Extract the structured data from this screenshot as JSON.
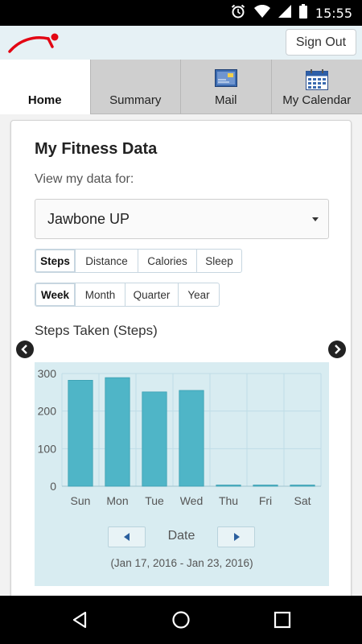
{
  "status_bar": {
    "time": "15:55",
    "icons": [
      "alarm-icon",
      "wifi-icon",
      "cell-signal-icon",
      "battery-icon"
    ]
  },
  "header": {
    "sign_out_label": "Sign Out",
    "logo": "brand-logo-swoosh"
  },
  "tabs": [
    {
      "label": "Home",
      "active": true
    },
    {
      "label": "Summary",
      "active": false
    },
    {
      "label": "Mail",
      "icon": "mail-icon",
      "active": false
    },
    {
      "label": "My Calendar",
      "icon": "calendar-icon",
      "active": false
    }
  ],
  "card": {
    "title": "My Fitness Data",
    "view_label": "View my data for:",
    "device_select": {
      "value": "Jawbone UP"
    },
    "metric_tabs": [
      {
        "label": "Steps",
        "active": true
      },
      {
        "label": "Distance",
        "active": false
      },
      {
        "label": "Calories",
        "active": false
      },
      {
        "label": "Sleep",
        "active": false
      }
    ],
    "period_tabs": [
      {
        "label": "Week",
        "active": true
      },
      {
        "label": "Month",
        "active": false
      },
      {
        "label": "Quarter",
        "active": false
      },
      {
        "label": "Year",
        "active": false
      }
    ],
    "chart_title": "Steps Taken (Steps)",
    "date_nav": {
      "label": "Date",
      "range": "(Jan 17, 2016 - Jan 23, 2016)"
    }
  },
  "colors": {
    "bar": "#4fb5c7",
    "chart_bg": "#d8ecf1",
    "accent": "#e30613"
  },
  "chart_data": {
    "type": "bar",
    "categories": [
      "Sun",
      "Mon",
      "Tue",
      "Wed",
      "Thu",
      "Fri",
      "Sat"
    ],
    "values": [
      282,
      289,
      251,
      255,
      0,
      0,
      0
    ],
    "title": "Steps Taken (Steps)",
    "xlabel": "Date",
    "ylabel": "",
    "ylim": [
      0,
      300
    ],
    "yticks": [
      0,
      100,
      200,
      300
    ],
    "grid": true
  }
}
